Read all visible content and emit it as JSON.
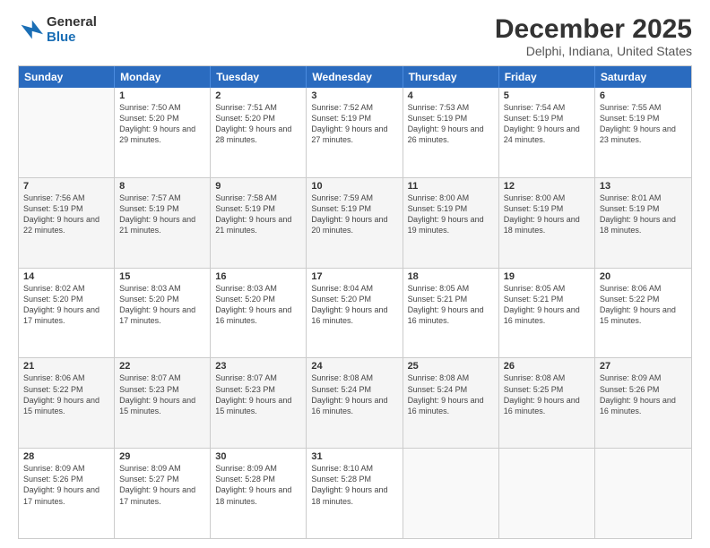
{
  "logo": {
    "line1": "General",
    "line2": "Blue"
  },
  "title": "December 2025",
  "subtitle": "Delphi, Indiana, United States",
  "days": [
    "Sunday",
    "Monday",
    "Tuesday",
    "Wednesday",
    "Thursday",
    "Friday",
    "Saturday"
  ],
  "rows": [
    [
      {
        "date": "",
        "sunrise": "",
        "sunset": "",
        "daylight": "",
        "empty": true
      },
      {
        "date": "1",
        "sunrise": "Sunrise: 7:50 AM",
        "sunset": "Sunset: 5:20 PM",
        "daylight": "Daylight: 9 hours and 29 minutes."
      },
      {
        "date": "2",
        "sunrise": "Sunrise: 7:51 AM",
        "sunset": "Sunset: 5:20 PM",
        "daylight": "Daylight: 9 hours and 28 minutes."
      },
      {
        "date": "3",
        "sunrise": "Sunrise: 7:52 AM",
        "sunset": "Sunset: 5:19 PM",
        "daylight": "Daylight: 9 hours and 27 minutes."
      },
      {
        "date": "4",
        "sunrise": "Sunrise: 7:53 AM",
        "sunset": "Sunset: 5:19 PM",
        "daylight": "Daylight: 9 hours and 26 minutes."
      },
      {
        "date": "5",
        "sunrise": "Sunrise: 7:54 AM",
        "sunset": "Sunset: 5:19 PM",
        "daylight": "Daylight: 9 hours and 24 minutes."
      },
      {
        "date": "6",
        "sunrise": "Sunrise: 7:55 AM",
        "sunset": "Sunset: 5:19 PM",
        "daylight": "Daylight: 9 hours and 23 minutes."
      }
    ],
    [
      {
        "date": "7",
        "sunrise": "Sunrise: 7:56 AM",
        "sunset": "Sunset: 5:19 PM",
        "daylight": "Daylight: 9 hours and 22 minutes."
      },
      {
        "date": "8",
        "sunrise": "Sunrise: 7:57 AM",
        "sunset": "Sunset: 5:19 PM",
        "daylight": "Daylight: 9 hours and 21 minutes."
      },
      {
        "date": "9",
        "sunrise": "Sunrise: 7:58 AM",
        "sunset": "Sunset: 5:19 PM",
        "daylight": "Daylight: 9 hours and 21 minutes."
      },
      {
        "date": "10",
        "sunrise": "Sunrise: 7:59 AM",
        "sunset": "Sunset: 5:19 PM",
        "daylight": "Daylight: 9 hours and 20 minutes."
      },
      {
        "date": "11",
        "sunrise": "Sunrise: 8:00 AM",
        "sunset": "Sunset: 5:19 PM",
        "daylight": "Daylight: 9 hours and 19 minutes."
      },
      {
        "date": "12",
        "sunrise": "Sunrise: 8:00 AM",
        "sunset": "Sunset: 5:19 PM",
        "daylight": "Daylight: 9 hours and 18 minutes."
      },
      {
        "date": "13",
        "sunrise": "Sunrise: 8:01 AM",
        "sunset": "Sunset: 5:19 PM",
        "daylight": "Daylight: 9 hours and 18 minutes."
      }
    ],
    [
      {
        "date": "14",
        "sunrise": "Sunrise: 8:02 AM",
        "sunset": "Sunset: 5:20 PM",
        "daylight": "Daylight: 9 hours and 17 minutes."
      },
      {
        "date": "15",
        "sunrise": "Sunrise: 8:03 AM",
        "sunset": "Sunset: 5:20 PM",
        "daylight": "Daylight: 9 hours and 17 minutes."
      },
      {
        "date": "16",
        "sunrise": "Sunrise: 8:03 AM",
        "sunset": "Sunset: 5:20 PM",
        "daylight": "Daylight: 9 hours and 16 minutes."
      },
      {
        "date": "17",
        "sunrise": "Sunrise: 8:04 AM",
        "sunset": "Sunset: 5:20 PM",
        "daylight": "Daylight: 9 hours and 16 minutes."
      },
      {
        "date": "18",
        "sunrise": "Sunrise: 8:05 AM",
        "sunset": "Sunset: 5:21 PM",
        "daylight": "Daylight: 9 hours and 16 minutes."
      },
      {
        "date": "19",
        "sunrise": "Sunrise: 8:05 AM",
        "sunset": "Sunset: 5:21 PM",
        "daylight": "Daylight: 9 hours and 16 minutes."
      },
      {
        "date": "20",
        "sunrise": "Sunrise: 8:06 AM",
        "sunset": "Sunset: 5:22 PM",
        "daylight": "Daylight: 9 hours and 15 minutes."
      }
    ],
    [
      {
        "date": "21",
        "sunrise": "Sunrise: 8:06 AM",
        "sunset": "Sunset: 5:22 PM",
        "daylight": "Daylight: 9 hours and 15 minutes."
      },
      {
        "date": "22",
        "sunrise": "Sunrise: 8:07 AM",
        "sunset": "Sunset: 5:23 PM",
        "daylight": "Daylight: 9 hours and 15 minutes."
      },
      {
        "date": "23",
        "sunrise": "Sunrise: 8:07 AM",
        "sunset": "Sunset: 5:23 PM",
        "daylight": "Daylight: 9 hours and 15 minutes."
      },
      {
        "date": "24",
        "sunrise": "Sunrise: 8:08 AM",
        "sunset": "Sunset: 5:24 PM",
        "daylight": "Daylight: 9 hours and 16 minutes."
      },
      {
        "date": "25",
        "sunrise": "Sunrise: 8:08 AM",
        "sunset": "Sunset: 5:24 PM",
        "daylight": "Daylight: 9 hours and 16 minutes."
      },
      {
        "date": "26",
        "sunrise": "Sunrise: 8:08 AM",
        "sunset": "Sunset: 5:25 PM",
        "daylight": "Daylight: 9 hours and 16 minutes."
      },
      {
        "date": "27",
        "sunrise": "Sunrise: 8:09 AM",
        "sunset": "Sunset: 5:26 PM",
        "daylight": "Daylight: 9 hours and 16 minutes."
      }
    ],
    [
      {
        "date": "28",
        "sunrise": "Sunrise: 8:09 AM",
        "sunset": "Sunset: 5:26 PM",
        "daylight": "Daylight: 9 hours and 17 minutes."
      },
      {
        "date": "29",
        "sunrise": "Sunrise: 8:09 AM",
        "sunset": "Sunset: 5:27 PM",
        "daylight": "Daylight: 9 hours and 17 minutes."
      },
      {
        "date": "30",
        "sunrise": "Sunrise: 8:09 AM",
        "sunset": "Sunset: 5:28 PM",
        "daylight": "Daylight: 9 hours and 18 minutes."
      },
      {
        "date": "31",
        "sunrise": "Sunrise: 8:10 AM",
        "sunset": "Sunset: 5:28 PM",
        "daylight": "Daylight: 9 hours and 18 minutes."
      },
      {
        "date": "",
        "sunrise": "",
        "sunset": "",
        "daylight": "",
        "empty": true
      },
      {
        "date": "",
        "sunrise": "",
        "sunset": "",
        "daylight": "",
        "empty": true
      },
      {
        "date": "",
        "sunrise": "",
        "sunset": "",
        "daylight": "",
        "empty": true
      }
    ]
  ]
}
